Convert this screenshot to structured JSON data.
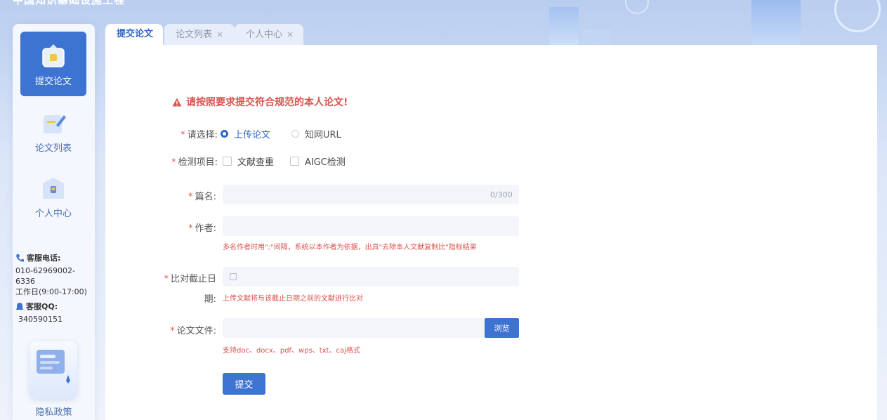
{
  "header": {
    "title": "中国知识基础设施工程"
  },
  "sidebar": {
    "items": [
      {
        "label": "提交论文",
        "icon": "upload-box-icon",
        "active": true
      },
      {
        "label": "论文列表",
        "icon": "edit-document-icon",
        "active": false
      },
      {
        "label": "个人中心",
        "icon": "personal-center-icon",
        "active": false
      }
    ],
    "contact": {
      "phone_heading": "客服电话:",
      "phone_number": "010-62969002-6336",
      "hours": "工作日(9:00-17:00)",
      "qq_heading": "客服QQ:",
      "qq_number": "340590151"
    },
    "privacy_label": "隐私政策"
  },
  "tabs": [
    {
      "label": "提交论文",
      "active": true
    },
    {
      "label": "论文列表",
      "close": "×"
    },
    {
      "label": "个人中心",
      "close": "×"
    }
  ],
  "form": {
    "warning": "请按照要求提交符合规范的本人论文!",
    "required_mark": "*",
    "select_label": "请选择:",
    "radio_upload": "上传论文",
    "radio_url": "知网URL",
    "check_label": "检测项目:",
    "check_dup": "文献查重",
    "check_aigc": "AIGC检测",
    "title_label": "篇名:",
    "title_value": "",
    "title_counter": "0/300",
    "author_label": "作者:",
    "author_value": "",
    "author_hint": "多名作者时用\";\"间隔，系统以本作者为依据，出具\"去除本人文献复制比\"指标结果",
    "date_label_1": "比对截止日",
    "date_label_2": "期:",
    "date_value": "",
    "date_hint": "上传文献将与该截止日期之前的文献进行比对",
    "file_label": "论文文件:",
    "file_value": "",
    "browse_label": "浏览",
    "file_hint": "支持doc、docx、pdf、wps、txt、caj格式",
    "submit_label": "提交"
  },
  "colors": {
    "accent": "#3d73d1",
    "warning": "#d9544f"
  }
}
